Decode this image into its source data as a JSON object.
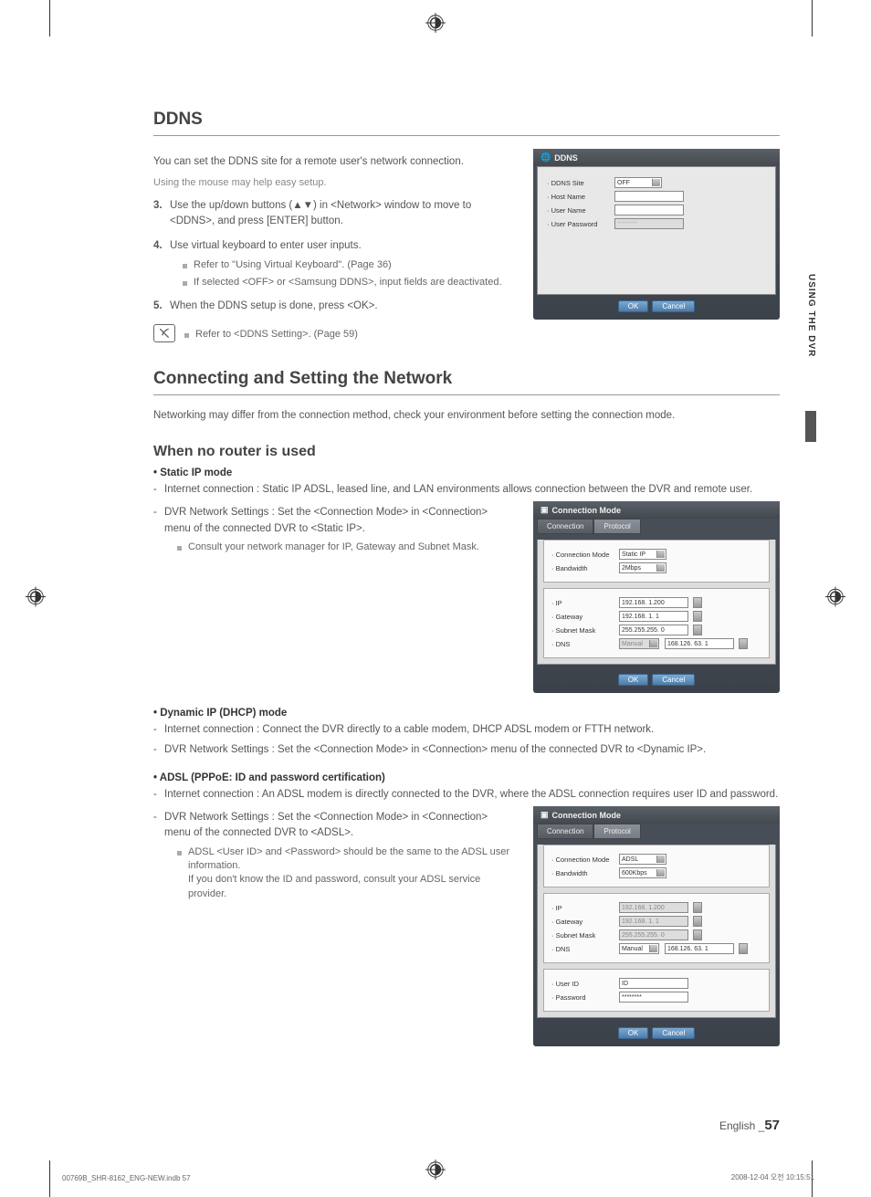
{
  "side_tab": "USING THE DVR",
  "headings": {
    "ddns": "DDNS",
    "connecting": "Connecting and Setting the Network",
    "no_router": "When no router is used"
  },
  "ddns": {
    "intro1": "You can set the DDNS site for a remote user's network connection.",
    "intro2": "Using the mouse may help easy setup.",
    "step3_num": "3.",
    "step3": "Use the up/down buttons (▲▼) in <Network> window to move to <DDNS>, and press [ENTER] button.",
    "step4_num": "4.",
    "step4": "Use virtual keyboard to enter user inputs.",
    "step4_sub1": "Refer to \"Using Virtual Keyboard\". (Page 36)",
    "step4_sub2": "If selected <OFF> or <Samsung DDNS>, input fields are deactivated.",
    "step5_num": "5.",
    "step5": "When the DDNS setup is done, press <OK>.",
    "note": "Refer to <DDNS Setting>. (Page 59)"
  },
  "connecting_intro": "Networking may differ from the connection method, check your environment before setting the connection mode.",
  "static": {
    "head": "• Static IP mode",
    "d1": "Internet connection : Static IP ADSL, leased line, and LAN environments allows connection between the DVR and remote user.",
    "d2": "DVR Network Settings : Set the <Connection Mode> in <Connection> menu of the connected DVR to <Static IP>.",
    "sub1": "Consult your network manager for IP, Gateway and Subnet Mask."
  },
  "dhcp": {
    "head": "• Dynamic IP (DHCP) mode",
    "d1": "Internet connection : Connect the DVR directly to a cable modem, DHCP ADSL modem or FTTH network.",
    "d2": "DVR Network Settings : Set the <Connection Mode> in <Connection> menu of the connected DVR to <Dynamic IP>."
  },
  "adsl": {
    "head": "• ADSL (PPPoE: ID and password certification)",
    "d1": "Internet connection : An ADSL modem is directly connected to the DVR, where the ADSL connection requires user ID and password.",
    "d2": "DVR Network Settings : Set the <Connection Mode> in <Connection> menu of the connected DVR to <ADSL>.",
    "sub1": "ADSL <User ID> and <Password> should be the same to the ADSL user information.",
    "sub2": "If you don't know the ID and password, consult your ADSL service provider."
  },
  "shot1": {
    "title": "DDNS",
    "labels": {
      "site": "· DDNS Site",
      "host": "· Host Name",
      "user": "· User Name",
      "pass": "· User Password"
    },
    "site_value": "OFF",
    "pass_value": "********",
    "ok": "OK",
    "cancel": "Cancel"
  },
  "shot2": {
    "title": "Connection Mode",
    "tab1": "Connection",
    "tab2": "Protocol",
    "labels": {
      "mode": "· Connection Mode",
      "bw": "· Bandwidth",
      "ip": "· IP",
      "gw": "· Gateway",
      "sm": "· Subnet Mask",
      "dns": "· DNS"
    },
    "mode_value": "Static IP",
    "bw_value": "2Mbps",
    "ip": "192.168.  1.200",
    "gw": "192.168.  1.  1",
    "sm": "255.255.255.  0",
    "dns_mode": "Manual",
    "dns": "168.126. 63.  1",
    "ok": "OK",
    "cancel": "Cancel"
  },
  "shot3": {
    "title": "Connection Mode",
    "tab1": "Connection",
    "tab2": "Protocol",
    "labels": {
      "mode": "· Connection Mode",
      "bw": "· Bandwidth",
      "ip": "· IP",
      "gw": "· Gateway",
      "sm": "· Subnet Mask",
      "dns": "· DNS",
      "uid": "· User ID",
      "pwd": "· Password"
    },
    "mode_value": "ADSL",
    "bw_value": "600Kbps",
    "ip": "192.168.  1.200",
    "gw": "192.168.  1.  1",
    "sm": "255.255.255.  0",
    "dns_mode": "Manual",
    "dns": "168.126. 63.  1",
    "uid": "ID",
    "pwd": "********",
    "ok": "OK",
    "cancel": "Cancel"
  },
  "footer": {
    "lang": "English _",
    "num": "57",
    "left": "00769B_SHR-8162_ENG-NEW.indb   57",
    "right": "2008-12-04   오전 10:15:51"
  }
}
